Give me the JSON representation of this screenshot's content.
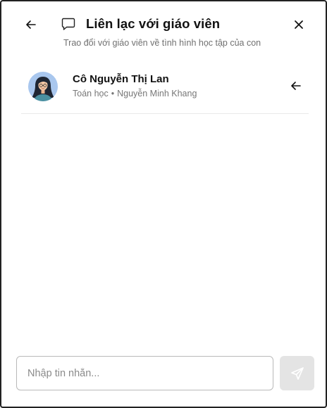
{
  "header": {
    "title": "Liên lạc với giáo viên",
    "subtitle": "Trao đổi với giáo viên về tình hình học tập của con",
    "back_icon": "arrow-left-icon",
    "chat_icon": "chat-bubble-icon",
    "close_icon": "close-icon"
  },
  "teacher": {
    "name": "Cô Nguyễn Thị Lan",
    "subject": "Toán học",
    "separator": "•",
    "student": "Nguyễn Minh Khang",
    "avatar_icon": "teacher-avatar",
    "action_icon": "arrow-left-icon"
  },
  "composer": {
    "placeholder": "Nhập tin nhắn...",
    "value": "",
    "send_icon": "send-icon"
  },
  "colors": {
    "text_primary": "#111111",
    "text_secondary": "#707070",
    "avatar_bg": "#a9c7ee",
    "send_disabled_bg": "#e4e4e4"
  }
}
